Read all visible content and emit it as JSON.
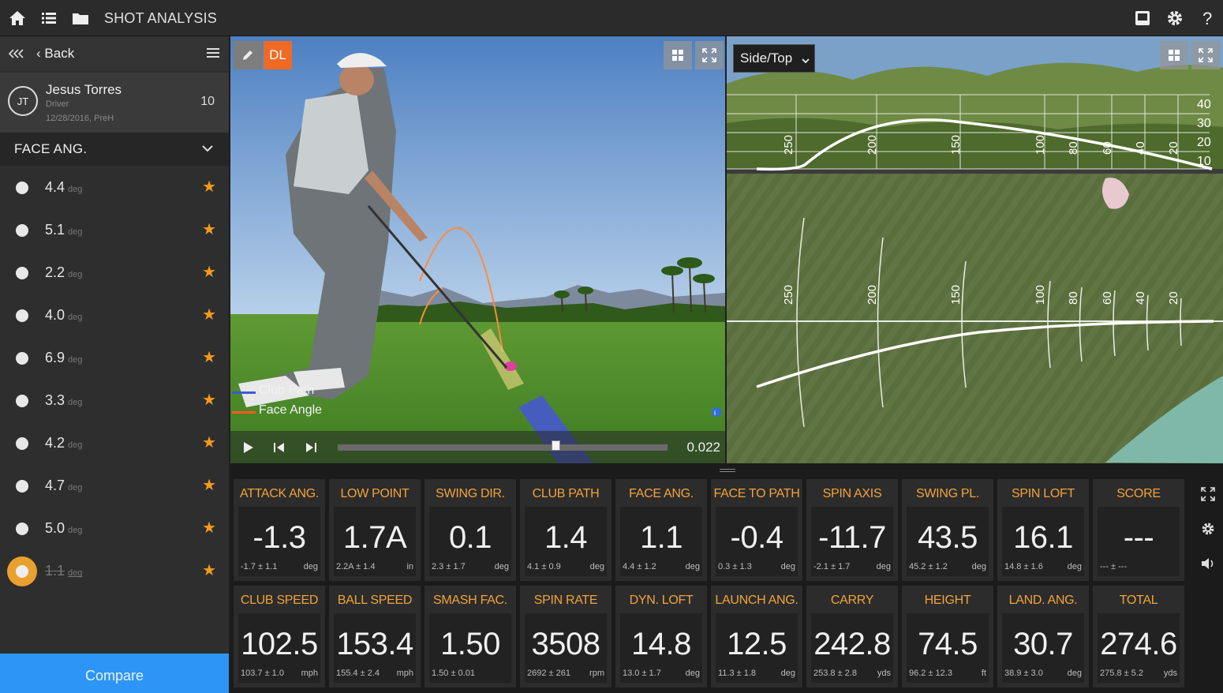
{
  "app": {
    "title": "SHOT ANALYSIS"
  },
  "sidebar": {
    "back_label": "Back",
    "player": {
      "initials": "JT",
      "name": "Jesus Torres",
      "club": "Driver",
      "date": "12/28/2016, PreH",
      "count": "10"
    },
    "parameter": "FACE ANG.",
    "shots": [
      {
        "value": "4.4",
        "unit": "deg",
        "active": false
      },
      {
        "value": "5.1",
        "unit": "deg",
        "active": false
      },
      {
        "value": "2.2",
        "unit": "deg",
        "active": false
      },
      {
        "value": "4.0",
        "unit": "deg",
        "active": false
      },
      {
        "value": "6.9",
        "unit": "deg",
        "active": false
      },
      {
        "value": "3.3",
        "unit": "deg",
        "active": false
      },
      {
        "value": "4.2",
        "unit": "deg",
        "active": false
      },
      {
        "value": "4.7",
        "unit": "deg",
        "active": false
      },
      {
        "value": "5.0",
        "unit": "deg",
        "active": false
      },
      {
        "value": "1.1",
        "unit": "deg",
        "active": true
      }
    ],
    "compare_label": "Compare"
  },
  "video": {
    "dl_label": "DL",
    "legend": [
      {
        "label": "Club Path",
        "color": "#3b5bd6"
      },
      {
        "label": "Face Angle",
        "color": "#ff5a1f"
      }
    ],
    "timecode": "0.022",
    "progress": 0.66
  },
  "trajectory": {
    "view": "Side/Top",
    "side_scale": [
      "40",
      "30",
      "20",
      "10"
    ],
    "distance_marks": [
      "250",
      "200",
      "150",
      "100",
      "80",
      "60",
      "40",
      "20"
    ]
  },
  "metrics_row1": [
    {
      "label": "ATTACK ANG.",
      "value": "-1.3",
      "sub": "-1.7 ± 1.1",
      "unit": "deg"
    },
    {
      "label": "LOW POINT",
      "value": "1.7A",
      "sub": "2.2A ± 1.4",
      "unit": "in"
    },
    {
      "label": "SWING DIR.",
      "value": "0.1",
      "sub": "2.3 ± 1.7",
      "unit": "deg"
    },
    {
      "label": "CLUB PATH",
      "value": "1.4",
      "sub": "4.1 ± 0.9",
      "unit": "deg"
    },
    {
      "label": "FACE ANG.",
      "value": "1.1",
      "sub": "4.4 ± 1.2",
      "unit": "deg"
    },
    {
      "label": "FACE TO PATH",
      "value": "-0.4",
      "sub": "0.3 ± 1.3",
      "unit": "deg"
    },
    {
      "label": "SPIN AXIS",
      "value": "-11.7",
      "sub": "-2.1 ± 1.7",
      "unit": "deg"
    },
    {
      "label": "SWING PL.",
      "value": "43.5",
      "sub": "45.2 ± 1.2",
      "unit": "deg"
    },
    {
      "label": "SPIN LOFT",
      "value": "16.1",
      "sub": "14.8 ± 1.6",
      "unit": "deg"
    },
    {
      "label": "SCORE",
      "value": "---",
      "sub": "--- ± ---",
      "unit": ""
    }
  ],
  "metrics_row2": [
    {
      "label": "CLUB SPEED",
      "value": "102.5",
      "sub": "103.7 ± 1.0",
      "unit": "mph"
    },
    {
      "label": "BALL SPEED",
      "value": "153.4",
      "sub": "155.4 ± 2.4",
      "unit": "mph"
    },
    {
      "label": "SMASH FAC.",
      "value": "1.50",
      "sub": "1.50 ± 0.01",
      "unit": ""
    },
    {
      "label": "SPIN RATE",
      "value": "3508",
      "sub": "2692 ± 261",
      "unit": "rpm"
    },
    {
      "label": "DYN. LOFT",
      "value": "14.8",
      "sub": "13.0 ± 1.7",
      "unit": "deg"
    },
    {
      "label": "LAUNCH ANG.",
      "value": "12.5",
      "sub": "11.3 ± 1.8",
      "unit": "deg"
    },
    {
      "label": "CARRY",
      "value": "242.8",
      "sub": "253.8 ± 2.8",
      "unit": "yds"
    },
    {
      "label": "HEIGHT",
      "value": "74.5",
      "sub": "96.2 ± 12.3",
      "unit": "ft"
    },
    {
      "label": "LAND. ANG.",
      "value": "30.7",
      "sub": "38.9 ± 3.0",
      "unit": "deg"
    },
    {
      "label": "TOTAL",
      "value": "274.6",
      "sub": "275.8 ± 5.2",
      "unit": "yds"
    }
  ],
  "colors": {
    "accent": "#f29a1f",
    "compare": "#2d95f5",
    "dl": "#f06a24"
  }
}
